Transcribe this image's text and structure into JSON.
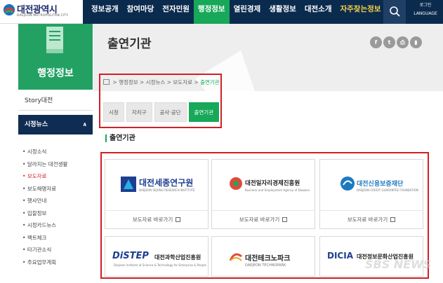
{
  "header": {
    "logo_title": "대전광역시",
    "logo_sub": "DAEJEON METROPOLITAN CITY",
    "nav": [
      "정보공개",
      "참여마당",
      "전자민원",
      "행정정보",
      "열린경제",
      "생활정보",
      "대전소개",
      "자주찾는정보"
    ],
    "login": "로그인",
    "language": "LANGUAGE"
  },
  "sidebar": {
    "banner_title": "행정정보",
    "story": "Story대전",
    "news": "시정뉴스",
    "news_caret": "∧",
    "items": [
      "시정소식",
      "달라지는 대전생활",
      "보도자료",
      "보도해명자료",
      "행사안내",
      "입찰정보",
      "시정카드뉴스",
      "팩트체크",
      "타기관소식",
      "주요업무계획"
    ]
  },
  "page": {
    "title": "출연기관",
    "breadcrumb": [
      "행정정보",
      "시정뉴스",
      "보도자료",
      "출연기관"
    ],
    "tabs": [
      "시청",
      "자치구",
      "공사·공단",
      "출연기관"
    ],
    "section_title": "출연기관"
  },
  "share_icons": [
    "f",
    "t",
    "⎙",
    "▮"
  ],
  "cards": [
    {
      "name": "대전세종연구원",
      "sub": "DAEJEON SEJONG RESEARCH INSTITUTE",
      "link": "보도자료 바로가기",
      "color": "#1d3f8f"
    },
    {
      "name": "대전일자리경제진흥원",
      "sub": "Business and Employment Agency of Daejeon",
      "link": "보도자료 바로가기",
      "color": "#222222"
    },
    {
      "name": "대전신용보증재단",
      "sub": "DAEJEON CREDIT GUARANTEE FOUNDATION",
      "link": "보도자료 바로가기",
      "color": "#1c79c0"
    },
    {
      "name": "대전과학산업진흥원",
      "brand": "DiSTEP",
      "sub": "Daejeon Institute of Science & Technology for Enterprise & People",
      "link": "",
      "color": "#222222"
    },
    {
      "name": "대전테크노파크",
      "sub": "DAEJEON TECHNOPARK",
      "link": "",
      "color": "#222222"
    },
    {
      "name": "대전정보문화산업진흥원",
      "brand": "DICIA",
      "sub": "",
      "link": "",
      "color": "#222222"
    }
  ],
  "watermark": "SBS NEWS",
  "colors": {
    "nav_bg": "#0b2b4e",
    "accent": "#17a85a",
    "highlight_box": "#d01f25"
  }
}
